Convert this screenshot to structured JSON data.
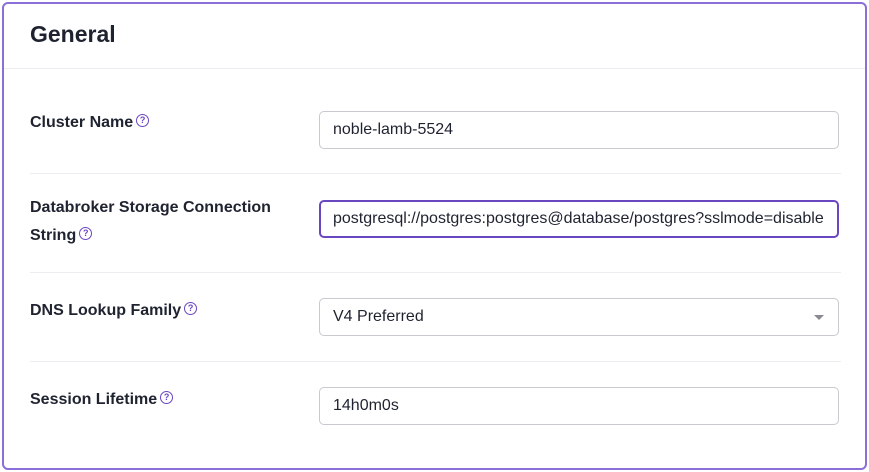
{
  "section": {
    "title": "General"
  },
  "help_icon_glyph": "?",
  "fields": [
    {
      "label": "Cluster Name",
      "value": "noble-lamb-5524"
    },
    {
      "label_line1": "Databroker Storage Connection",
      "label_line2": "String",
      "value": "postgresql://postgres:postgres@database/postgres?sslmode=disable"
    },
    {
      "label": "DNS Lookup Family",
      "value": "V4 Preferred"
    },
    {
      "label": "Session Lifetime",
      "value": "14h0m0s"
    }
  ],
  "colors": {
    "accent": "#6b46c1",
    "panel_border": "#8b6fd6",
    "text": "#1f2330",
    "input_border": "#c9c9cf"
  },
  "icons": {
    "help": "question-circle-icon",
    "dropdown": "chevron-down-icon"
  }
}
